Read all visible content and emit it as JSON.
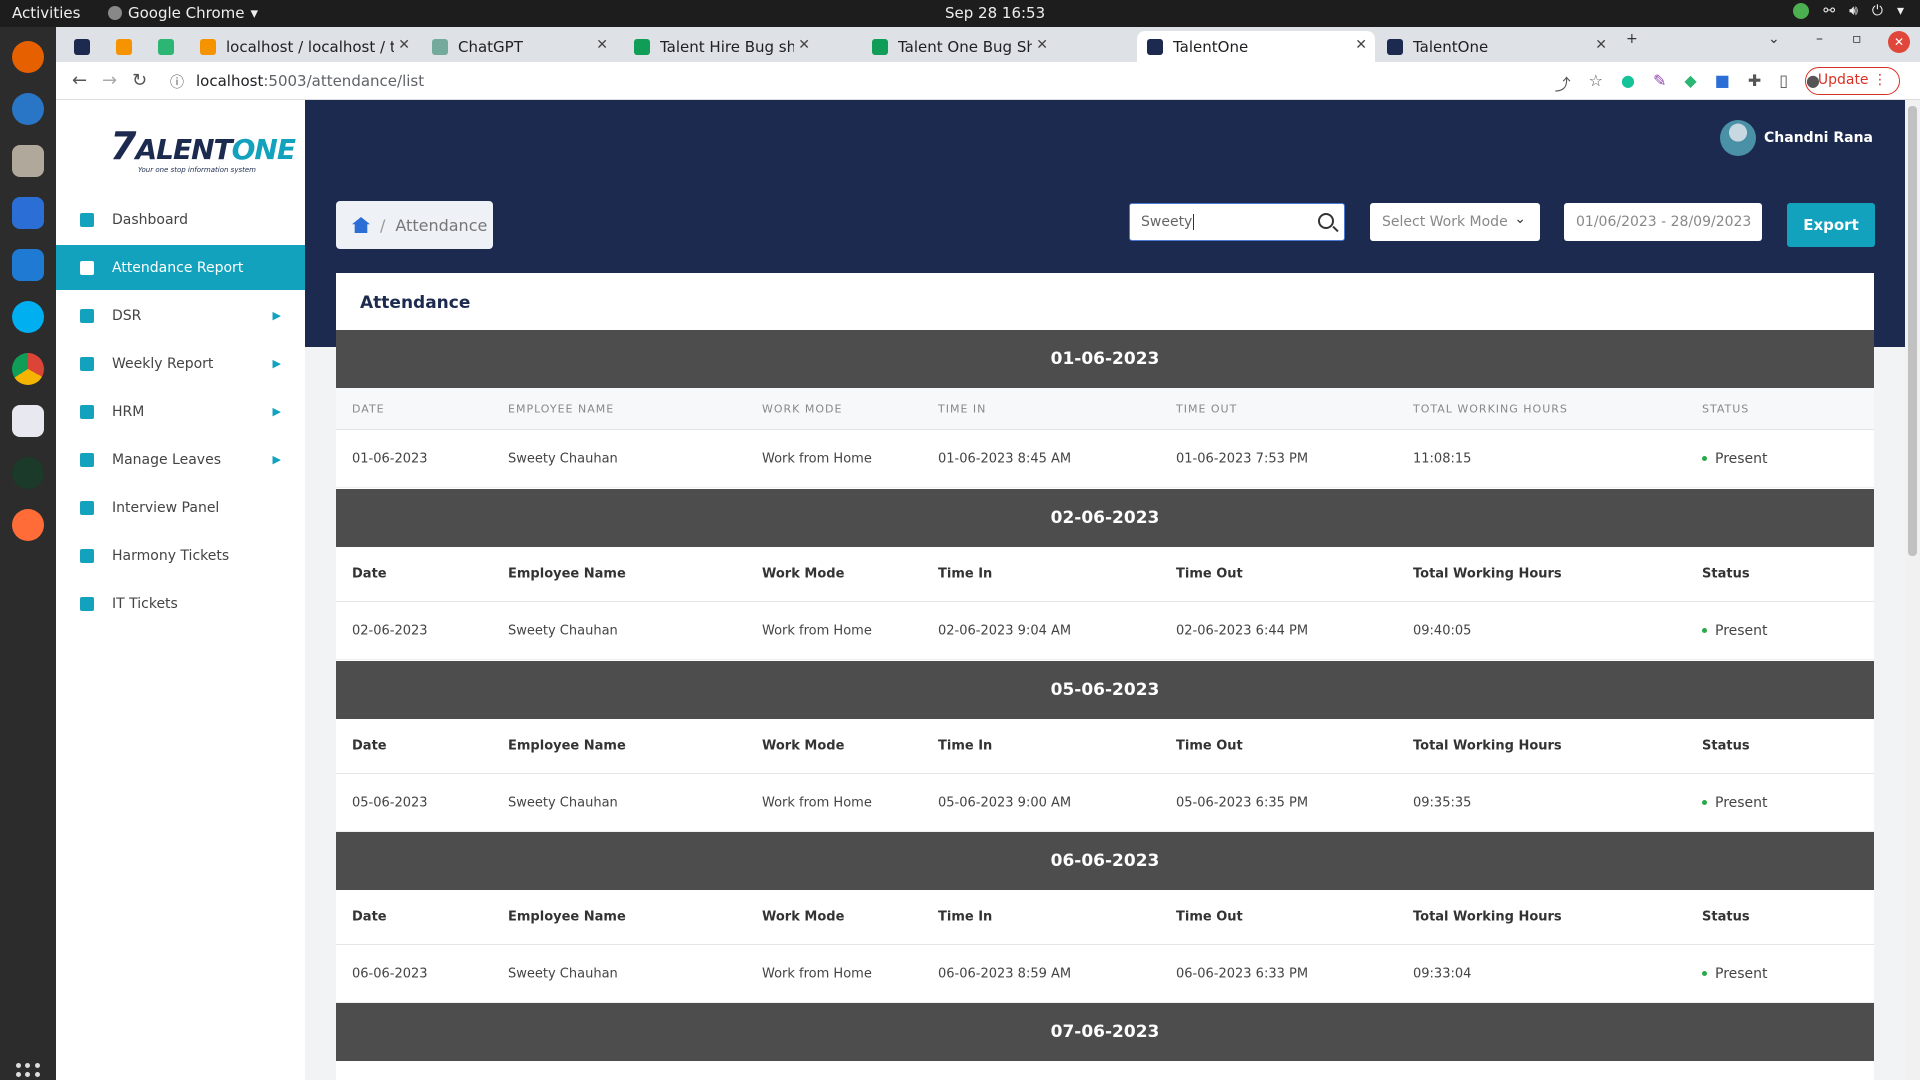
{
  "os": {
    "activities": "Activities",
    "app_name": "Google Chrome",
    "clock": "Sep 28  16:53"
  },
  "browser": {
    "tabs": [
      {
        "label": "",
        "fav_color": "#1b2a4e",
        "active": false
      },
      {
        "label": "",
        "fav_color": "#f59300",
        "active": false
      },
      {
        "label": "",
        "fav_color": "#2bb673",
        "active": false
      },
      {
        "label": "localhost / localhost / tale",
        "fav_color": "#f59300",
        "active": false
      },
      {
        "label": "ChatGPT",
        "fav_color": "#74aa9c",
        "active": false
      },
      {
        "label": "Talent Hire Bug sheet - Go",
        "fav_color": "#0f9d58",
        "active": false
      },
      {
        "label": "Talent One Bug Sheet - Go",
        "fav_color": "#0f9d58",
        "active": false
      },
      {
        "label": "TalentOne",
        "fav_color": "#1b2a4e",
        "active": true
      },
      {
        "label": "TalentOne",
        "fav_color": "#1b2a4e",
        "active": false
      }
    ],
    "url_host": "localhost",
    "url_path": ":5003/attendance/list",
    "update_label": "Update"
  },
  "app": {
    "logo_main": "ALENT",
    "logo_one": "ONE",
    "logo_tagline": "Your one stop information system",
    "user_name": "Chandni Rana",
    "breadcrumb": "Attendance",
    "search_value": "Sweety",
    "work_mode_placeholder": "Select Work Mode",
    "date_range": "01/06/2023 - 28/09/2023",
    "export_label": "Export",
    "card_title": "Attendance",
    "accent_color": "#12a2bd",
    "nav": [
      {
        "label": "Dashboard",
        "has_caret": false,
        "active": false
      },
      {
        "label": "Attendance Report",
        "has_caret": false,
        "active": true
      },
      {
        "label": "DSR",
        "has_caret": true,
        "active": false
      },
      {
        "label": "Weekly Report",
        "has_caret": true,
        "active": false
      },
      {
        "label": "HRM",
        "has_caret": true,
        "active": false
      },
      {
        "label": "Manage Leaves",
        "has_caret": true,
        "active": false
      },
      {
        "label": "Interview Panel",
        "has_caret": false,
        "active": false
      },
      {
        "label": "Harmony Tickets",
        "has_caret": false,
        "active": false
      },
      {
        "label": "IT Tickets",
        "has_caret": false,
        "active": false
      }
    ]
  },
  "table": {
    "columns_upper": [
      "DATE",
      "EMPLOYEE NAME",
      "WORK MODE",
      "TIME IN",
      "TIME OUT",
      "TOTAL WORKING HOURS",
      "STATUS"
    ],
    "columns": [
      "Date",
      "Employee Name",
      "Work Mode",
      "Time In",
      "Time Out",
      "Total Working Hours",
      "Status"
    ],
    "groups": [
      {
        "date": "01-06-2023",
        "row": [
          "01-06-2023",
          "Sweety Chauhan",
          "Work from Home",
          "01-06-2023 8:45 AM",
          "01-06-2023 7:53 PM",
          "11:08:15",
          "Present"
        ]
      },
      {
        "date": "02-06-2023",
        "row": [
          "02-06-2023",
          "Sweety Chauhan",
          "Work from Home",
          "02-06-2023 9:04 AM",
          "02-06-2023 6:44 PM",
          "09:40:05",
          "Present"
        ]
      },
      {
        "date": "05-06-2023",
        "row": [
          "05-06-2023",
          "Sweety Chauhan",
          "Work from Home",
          "05-06-2023 9:00 AM",
          "05-06-2023 6:35 PM",
          "09:35:35",
          "Present"
        ]
      },
      {
        "date": "06-06-2023",
        "row": [
          "06-06-2023",
          "Sweety Chauhan",
          "Work from Home",
          "06-06-2023 8:59 AM",
          "06-06-2023 6:33 PM",
          "09:33:04",
          "Present"
        ]
      },
      {
        "date": "07-06-2023",
        "row": null
      }
    ]
  }
}
